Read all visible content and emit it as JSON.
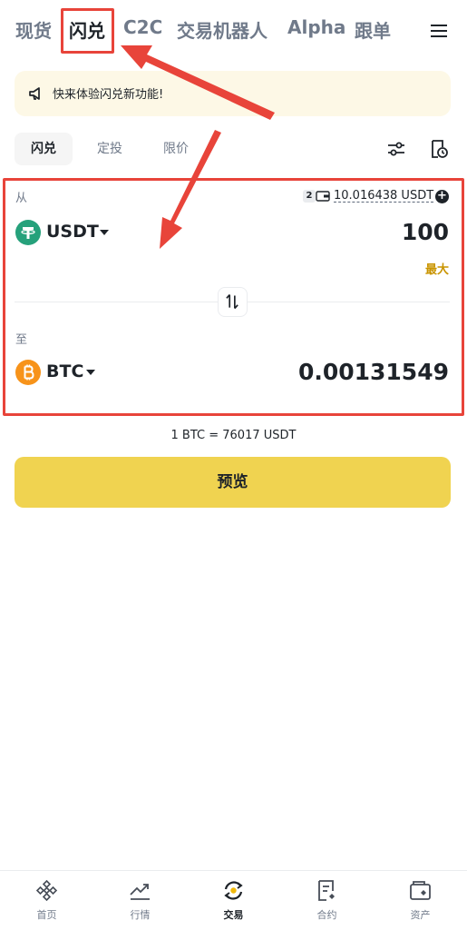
{
  "top_nav": {
    "tabs": [
      "现货",
      "闪兑",
      "C2C",
      "交易机器人",
      "Alpha",
      "跟单"
    ],
    "active_index": 1
  },
  "banner": {
    "text": "快来体验闪兑新功能!"
  },
  "mode_tabs": {
    "labels": [
      "闪兑",
      "定投",
      "限价"
    ],
    "active_index": 0
  },
  "from": {
    "label": "从",
    "balance_badge": "2",
    "balance": "10.016438 USDT",
    "coin": "USDT",
    "amount": "100",
    "max_label": "最大"
  },
  "to": {
    "label": "至",
    "coin": "BTC",
    "amount": "0.00131549"
  },
  "rate": "1 BTC = 76017 USDT",
  "preview_button": "预览",
  "bottom_nav": {
    "items": [
      "首页",
      "行情",
      "交易",
      "合约",
      "资产"
    ],
    "active_index": 2
  },
  "colors": {
    "accent_yellow": "#f0d350",
    "max_gold": "#c99400",
    "annotation_red": "#e8443a",
    "usdt_green": "#26a17b",
    "btc_orange": "#f7931a"
  },
  "icons": [
    "menu-icon",
    "megaphone-icon",
    "settings-sliders-icon",
    "history-icon",
    "wallet-icon",
    "plus-icon",
    "usdt-coin-icon",
    "btc-coin-icon",
    "swap-direction-icon",
    "home-icon",
    "markets-icon",
    "trade-icon",
    "futures-icon",
    "assets-icon"
  ]
}
